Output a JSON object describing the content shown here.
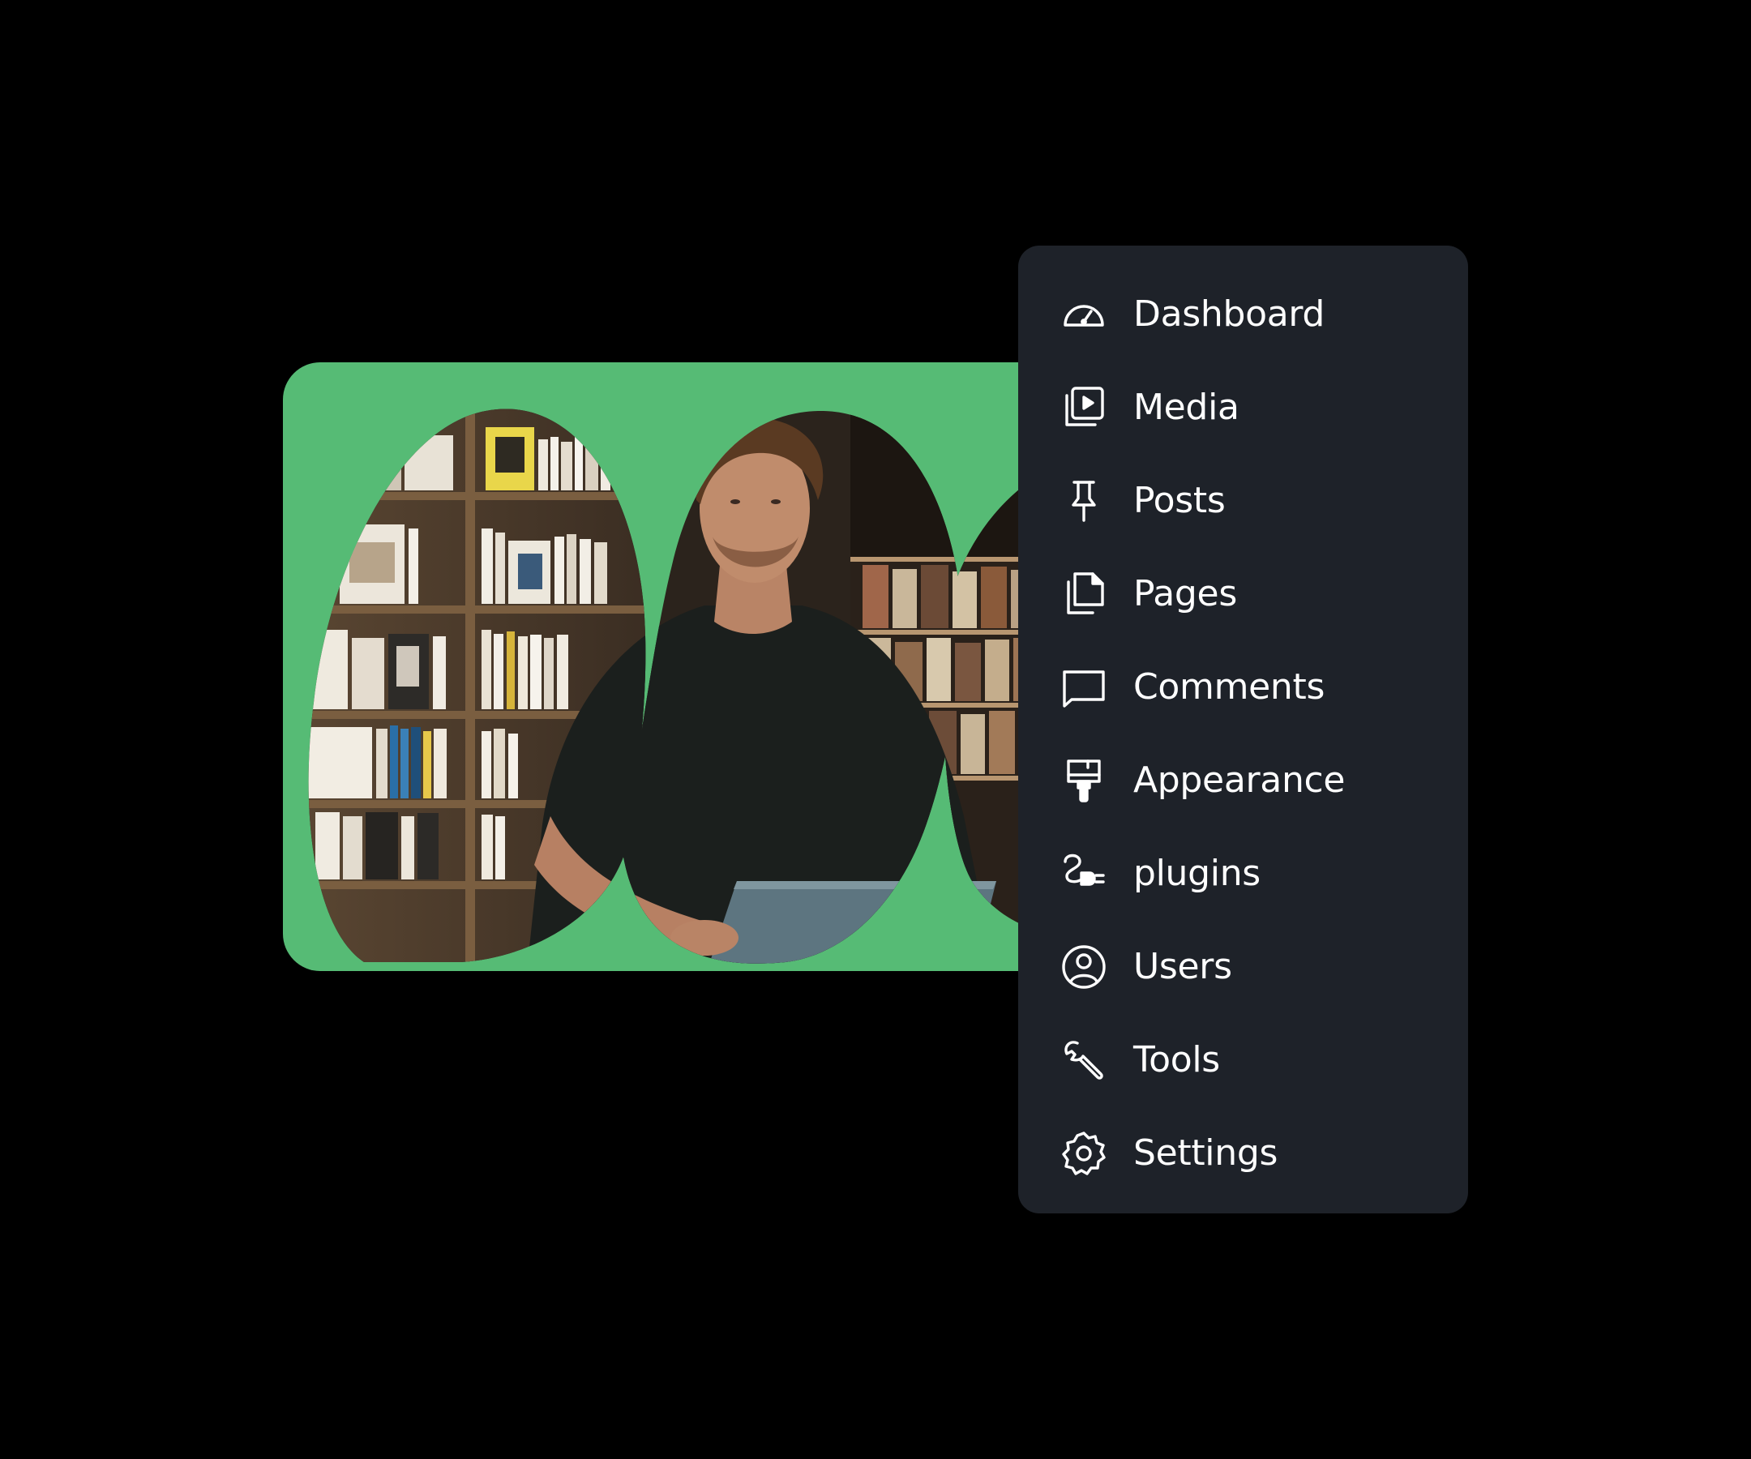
{
  "colors": {
    "background": "#000000",
    "card_green": "#56bb75",
    "menu_bg": "#1e2229",
    "menu_text": "#ffffff"
  },
  "menu": {
    "items": [
      {
        "label": "Dashboard",
        "icon": "dashboard-gauge-icon"
      },
      {
        "label": "Media",
        "icon": "media-play-icon"
      },
      {
        "label": "Posts",
        "icon": "pushpin-icon"
      },
      {
        "label": "Pages",
        "icon": "pages-icon"
      },
      {
        "label": "Comments",
        "icon": "comment-icon"
      },
      {
        "label": "Appearance",
        "icon": "paintbrush-icon"
      },
      {
        "label": "plugins",
        "icon": "plug-icon"
      },
      {
        "label": "Users",
        "icon": "user-circle-icon"
      },
      {
        "label": "Tools",
        "icon": "wrench-icon"
      },
      {
        "label": "Settings",
        "icon": "gear-icon"
      }
    ]
  }
}
